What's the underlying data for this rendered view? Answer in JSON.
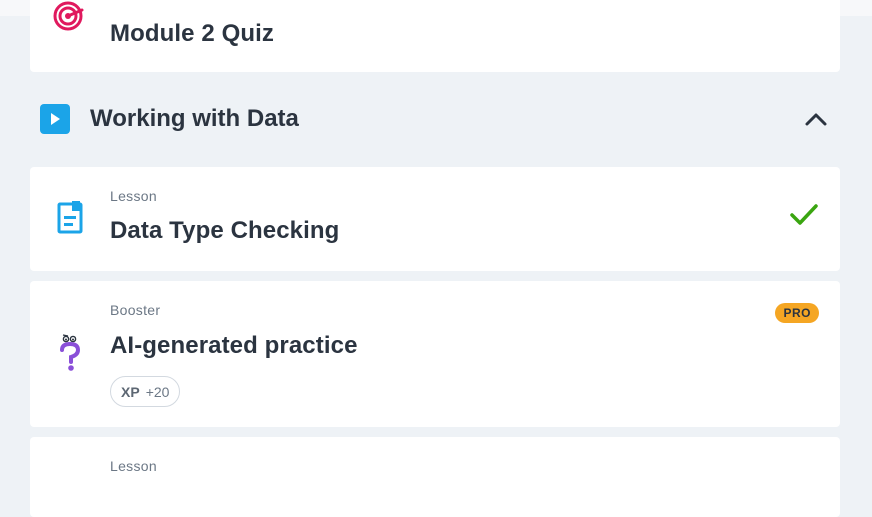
{
  "quiz_item": {
    "title": "Module 2 Quiz",
    "icon": "target-icon"
  },
  "section": {
    "title": "Working with Data",
    "icon": "play-icon",
    "toggle_icon": "chevron-up-icon",
    "accent_color": "#1ba4e8"
  },
  "items": [
    {
      "type": "Lesson",
      "title": "Data Type Checking",
      "icon": "document-icon",
      "status": "completed",
      "status_icon": "checkmark-icon",
      "status_color": "#3aa510"
    },
    {
      "type": "Booster",
      "title": "AI-generated practice",
      "icon": "question-mark-icon",
      "badge": "PRO",
      "badge_color": "#f5a623",
      "xp_label": "XP",
      "xp_value": "+20"
    },
    {
      "type": "Lesson"
    }
  ]
}
